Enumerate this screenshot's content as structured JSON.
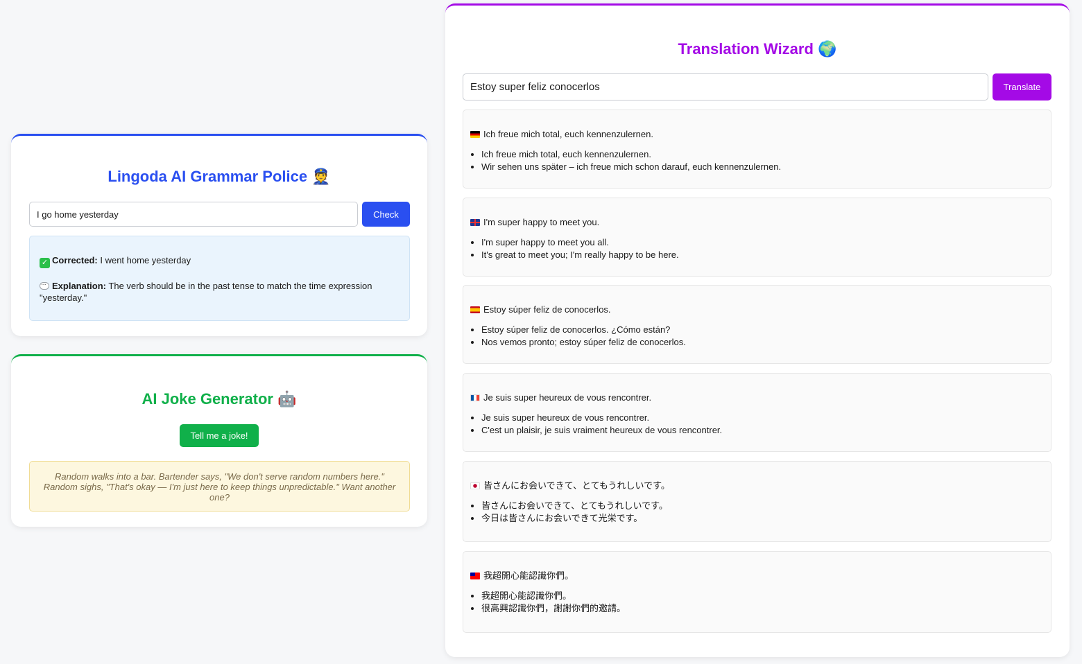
{
  "grammar": {
    "title": "Lingoda AI Grammar Police",
    "title_emoji": "👮",
    "input_value": "I go home yesterday",
    "check_label": "Check",
    "corrected_label": "Corrected:",
    "corrected_text": " I went home yesterday",
    "explanation_label": "Explanation:",
    "explanation_text": " The verb should be in the past tense to match the time expression \"yesterday.\"",
    "colors": {
      "accent": "#2a4ff0",
      "result_bg": "#eaf4fd"
    }
  },
  "joke": {
    "title": "AI Joke Generator",
    "title_emoji": "🤖",
    "button_label": "Tell me a joke!",
    "joke_text": "Random walks into a bar. Bartender says, \"We don't serve random numbers here.\" Random sighs, \"That's okay — I'm just here to keep things unpredictable.\" Want another one?",
    "colors": {
      "accent": "#10b04a",
      "joke_bg": "#fdf7df"
    }
  },
  "translate": {
    "title": "Translation Wizard",
    "title_emoji": "🌍",
    "input_value": "Estoy super feliz conocerlos",
    "button_label": "Translate",
    "colors": {
      "accent": "#a40ae6"
    },
    "results": [
      {
        "flag": "flag-de",
        "main": "Ich freue mich total, euch kennenzulernen.",
        "alternatives": [
          "Ich freue mich total, euch kennenzulernen.",
          "Wir sehen uns später – ich freue mich schon darauf, euch kennenzulernen."
        ]
      },
      {
        "flag": "flag-gb",
        "main": "I'm super happy to meet you.",
        "alternatives": [
          "I'm super happy to meet you all.",
          "It's great to meet you; I'm really happy to be here."
        ]
      },
      {
        "flag": "flag-es",
        "main": "Estoy súper feliz de conocerlos.",
        "alternatives": [
          "Estoy súper feliz de conocerlos. ¿Cómo están?",
          "Nos vemos pronto; estoy súper feliz de conocerlos."
        ]
      },
      {
        "flag": "flag-fr",
        "main": "Je suis super heureux de vous rencontrer.",
        "alternatives": [
          "Je suis super heureux de vous rencontrer.",
          "C'est un plaisir, je suis vraiment heureux de vous rencontrer."
        ]
      },
      {
        "flag": "flag-jp",
        "main": "皆さんにお会いできて、とてもうれしいです。",
        "alternatives": [
          "皆さんにお会いできて、とてもうれしいです。",
          "今日は皆さんにお会いできて光栄です。"
        ]
      },
      {
        "flag": "flag-tw",
        "main": "我超開心能認識你們。",
        "alternatives": [
          "我超開心能認識你們。",
          "很高興認識你們，謝謝你們的邀請。"
        ]
      }
    ]
  }
}
